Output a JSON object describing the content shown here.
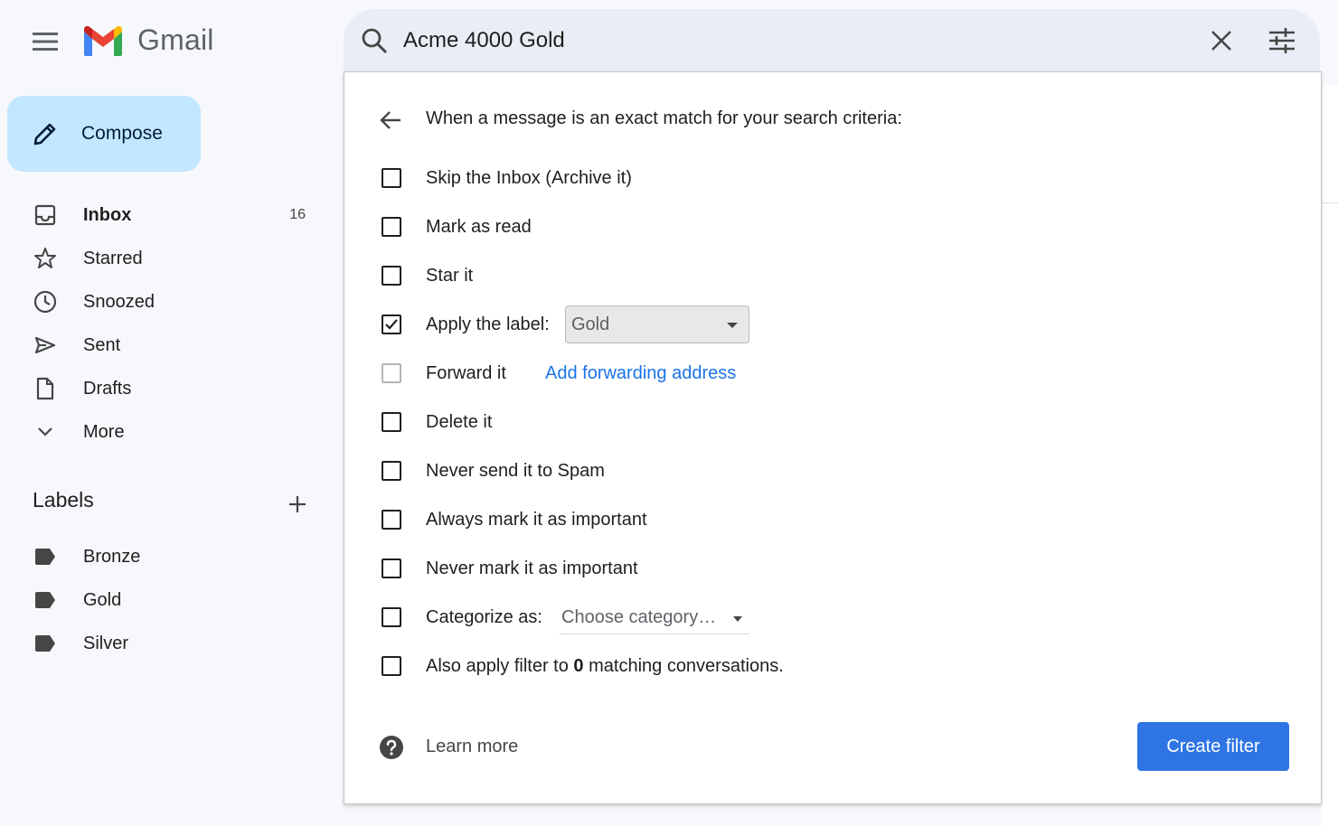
{
  "app": {
    "name": "Gmail",
    "menu_icon": "hamburger-icon",
    "logo_icon": "gmail-m-logo"
  },
  "compose": {
    "label": "Compose",
    "icon": "pencil-icon"
  },
  "nav": [
    {
      "label": "Inbox",
      "count": "16",
      "icon": "inbox-icon",
      "bold": true
    },
    {
      "label": "Starred",
      "count": "",
      "icon": "star-icon"
    },
    {
      "label": "Snoozed",
      "count": "",
      "icon": "clock-icon"
    },
    {
      "label": "Sent",
      "count": "",
      "icon": "send-icon"
    },
    {
      "label": "Drafts",
      "count": "",
      "icon": "file-icon"
    },
    {
      "label": "More",
      "count": "",
      "icon": "chevron-down-icon"
    }
  ],
  "labels": {
    "title": "Labels",
    "add_icon": "plus-icon",
    "items": [
      {
        "label": "Bronze",
        "icon": "label-icon"
      },
      {
        "label": "Gold",
        "icon": "label-icon"
      },
      {
        "label": "Silver",
        "icon": "label-icon"
      }
    ]
  },
  "search": {
    "query": "Acme 4000 Gold",
    "search_icon": "search-icon",
    "clear_icon": "close-icon",
    "options_icon": "tune-icon"
  },
  "filter": {
    "heading": "When a message is an exact match for your search criteria:",
    "options": {
      "skip_inbox": {
        "label": "Skip the Inbox (Archive it)",
        "checked": false
      },
      "mark_read": {
        "label": "Mark as read",
        "checked": false
      },
      "star": {
        "label": "Star it",
        "checked": false
      },
      "apply_label": {
        "label": "Apply the label:",
        "checked": true,
        "value": "Gold"
      },
      "forward": {
        "label": "Forward it",
        "checked": false,
        "disabled": true,
        "link": "Add forwarding address"
      },
      "delete": {
        "label": "Delete it",
        "checked": false
      },
      "never_spam": {
        "label": "Never send it to Spam",
        "checked": false
      },
      "always_important": {
        "label": "Always mark it as important",
        "checked": false
      },
      "never_important": {
        "label": "Never mark it as important",
        "checked": false
      },
      "categorize": {
        "label": "Categorize as:",
        "checked": false,
        "placeholder": "Choose category…"
      },
      "also_apply": {
        "prefix": "Also apply filter to ",
        "count": "0",
        "suffix": " matching conversations.",
        "checked": false
      }
    },
    "learn_more": "Learn more",
    "create_button": "Create filter"
  },
  "colors": {
    "background": "#f6f8fc",
    "compose": "#c2e7ff",
    "search_bar": "#e9eef6",
    "accent_link": "#1a73e8",
    "primary_button": "#2e75e3"
  }
}
